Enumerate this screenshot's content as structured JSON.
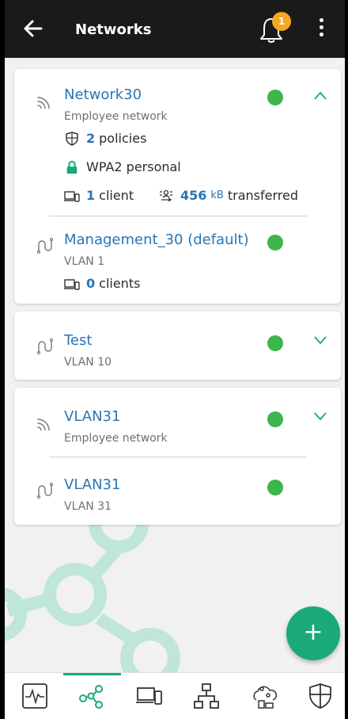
{
  "header": {
    "title": "Networks",
    "notification_count": "1"
  },
  "cards": [
    {
      "networks": [
        {
          "name": "Network30",
          "subtitle": "Employee network",
          "policies_count": "2",
          "policies_label": "policies",
          "security": "WPA2 personal",
          "clients_count": "1",
          "clients_label": "client",
          "transfer_value": "456",
          "transfer_unit": "kB",
          "transfer_label": "transferred",
          "status": "online"
        },
        {
          "name": "Management_30 (default)",
          "subtitle": "VLAN 1",
          "clients_count": "0",
          "clients_label": "clients",
          "status": "online"
        }
      ],
      "expanded": true
    },
    {
      "networks": [
        {
          "name": "Test",
          "subtitle": "VLAN 10",
          "status": "online"
        }
      ],
      "expanded": false
    },
    {
      "networks": [
        {
          "name": "VLAN31",
          "subtitle": "Employee network",
          "status": "online"
        },
        {
          "name": "VLAN31",
          "subtitle": "VLAN 31",
          "status": "online"
        }
      ],
      "expanded": false
    }
  ],
  "fab": {
    "label": "+"
  },
  "colors": {
    "accent": "#19a97b",
    "link": "#2a75b3",
    "status_online": "#3cb54a",
    "badge": "#f5a623",
    "header_bg": "#1a1a1a"
  },
  "bottom_nav": {
    "items": [
      "activity-icon",
      "networks-icon",
      "devices-icon",
      "topology-icon",
      "clients-icon",
      "security-icon"
    ],
    "active_index": 1
  }
}
